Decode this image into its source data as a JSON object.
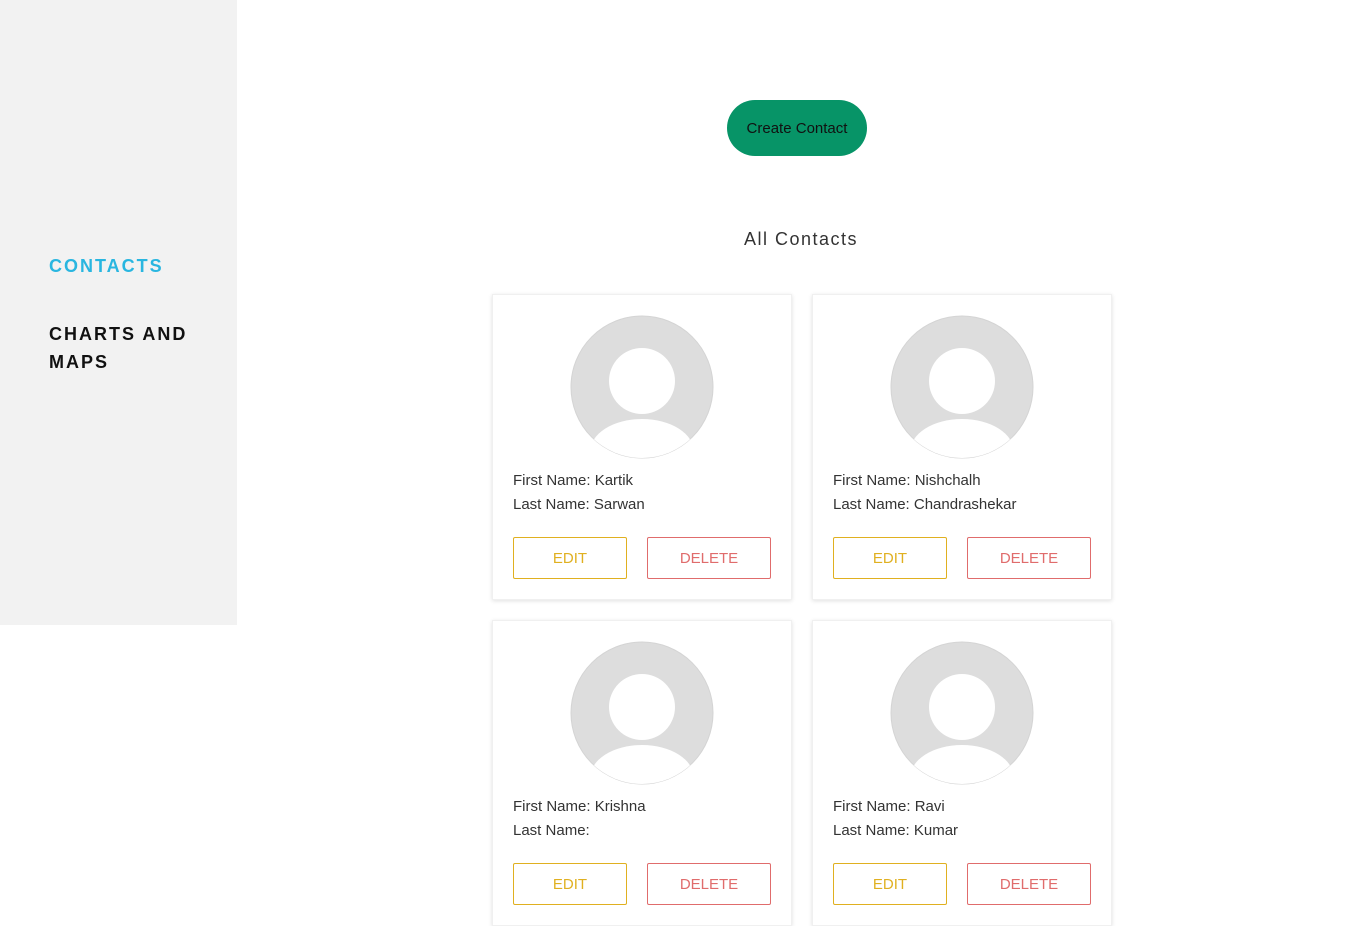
{
  "sidebar": {
    "items": [
      {
        "label": "CONTACTS"
      },
      {
        "label": "CHARTS AND MAPS"
      }
    ]
  },
  "main": {
    "create_label": "Create Contact",
    "section_title": "All Contacts",
    "first_name_label": "First Name:",
    "last_name_label": "Last Name:",
    "edit_label": "EDIT",
    "delete_label": "DELETE",
    "contacts": [
      {
        "first": "Kartik",
        "last": "Sarwan"
      },
      {
        "first": "Nishchalh",
        "last": "Chandrashekar"
      },
      {
        "first": "Krishna",
        "last": ""
      },
      {
        "first": "Ravi",
        "last": "Kumar"
      }
    ]
  },
  "colors": {
    "accent": "#29b6e0",
    "create_button": "#079467",
    "edit": "#e0b020",
    "delete": "#e06c6c",
    "avatar": "#dddddd"
  },
  "icons": {
    "avatar": "user-avatar-icon"
  }
}
